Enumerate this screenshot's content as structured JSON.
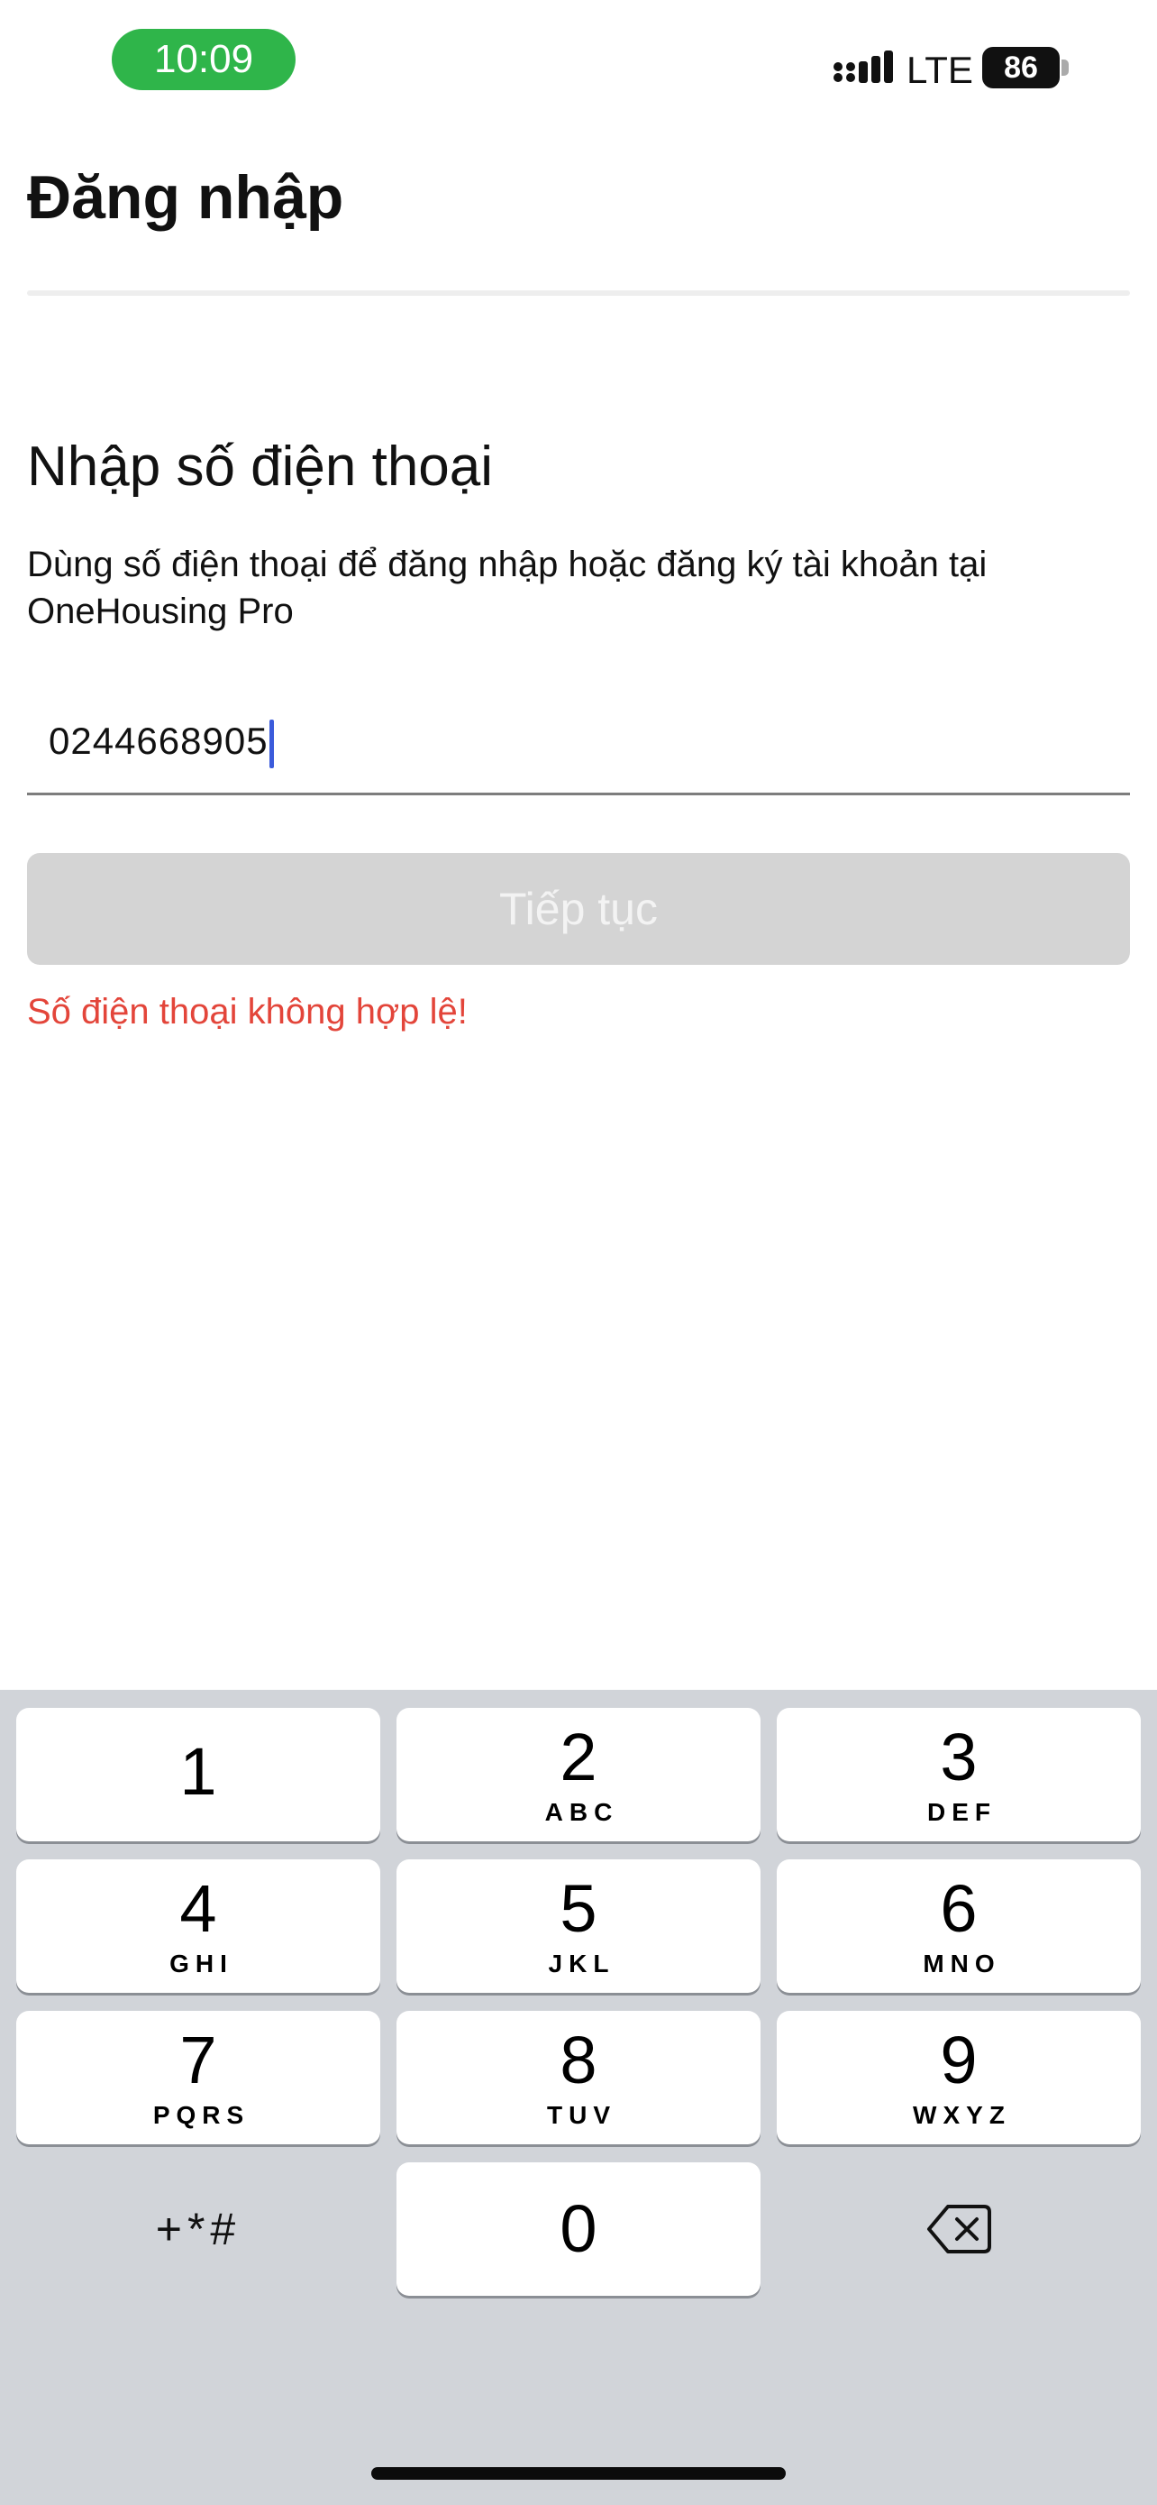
{
  "status_bar": {
    "time": "10:09",
    "network": "LTE",
    "battery": "86",
    "colors": {
      "time_pill": "#2fb54a"
    }
  },
  "header": {
    "title": "Đăng nhập"
  },
  "login": {
    "heading": "Nhập số điện thoại",
    "description": "Dùng số điện thoại để đăng nhập hoặc đăng ký tài khoản tại OneHousing Pro",
    "phone_value": "0244668905",
    "continue_label": "Tiếp tục",
    "error": "Số điện thoại không hợp lệ!",
    "colors": {
      "error": "#e3453a",
      "caret": "#3b5bdb",
      "button_disabled": "#d4d4d4"
    }
  },
  "keyboard": {
    "keys": [
      {
        "digit": "1",
        "letters": ""
      },
      {
        "digit": "2",
        "letters": "ABC"
      },
      {
        "digit": "3",
        "letters": "DEF"
      },
      {
        "digit": "4",
        "letters": "GHI"
      },
      {
        "digit": "5",
        "letters": "JKL"
      },
      {
        "digit": "6",
        "letters": "MNO"
      },
      {
        "digit": "7",
        "letters": "PQRS"
      },
      {
        "digit": "8",
        "letters": "TUV"
      },
      {
        "digit": "9",
        "letters": "WXYZ"
      },
      {
        "digit": "0",
        "letters": ""
      }
    ],
    "symbols_label": "+*#",
    "delete_icon": "backspace-icon"
  }
}
